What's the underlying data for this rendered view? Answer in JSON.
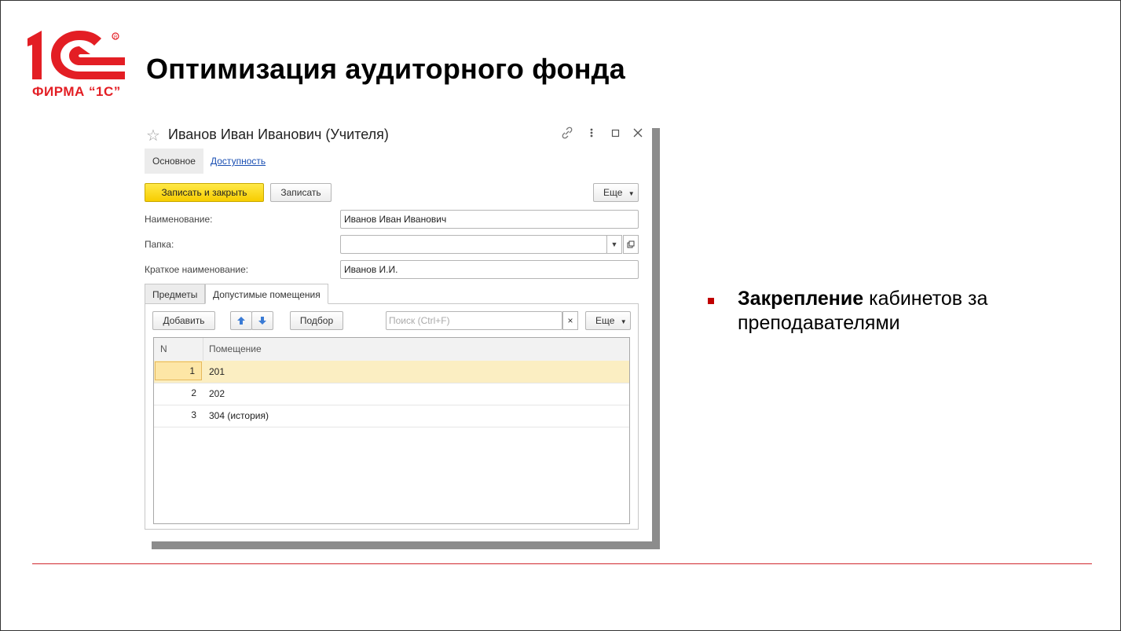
{
  "slide": {
    "title": "Оптимизация аудиторного фонда",
    "logo_text": "ФИРМА “1С”",
    "bullet_bold": "Закрепление",
    "bullet_rest": " кабинетов за преподавателями"
  },
  "window": {
    "title": "Иванов Иван Иванович (Учителя)",
    "nav_tabs": [
      "Основное",
      "Доступность"
    ],
    "toolbar": {
      "save_close": "Записать и закрыть",
      "save": "Записать",
      "more": "Еще"
    },
    "fields": {
      "name_label": "Наименование:",
      "name_value": "Иванов Иван Иванович",
      "folder_label": "Папка:",
      "folder_value": "",
      "short_label": "Краткое наименование:",
      "short_value": "Иванов И.И."
    },
    "tabs": [
      "Предметы",
      "Допустимые помещения"
    ],
    "panel_toolbar": {
      "add": "Добавить",
      "pick": "Подбор",
      "search_placeholder": "Поиск (Ctrl+F)",
      "more": "Еще"
    },
    "table": {
      "columns": [
        "N",
        "Помещение"
      ],
      "rows": [
        {
          "n": "1",
          "room": "201"
        },
        {
          "n": "2",
          "room": "202"
        },
        {
          "n": "3",
          "room": "304 (история)"
        }
      ]
    }
  },
  "colors": {
    "brand_red": "#e31e24",
    "primary_button": "#f7cd00",
    "selected_row": "#fbeec2",
    "link": "#1a4fb3"
  }
}
